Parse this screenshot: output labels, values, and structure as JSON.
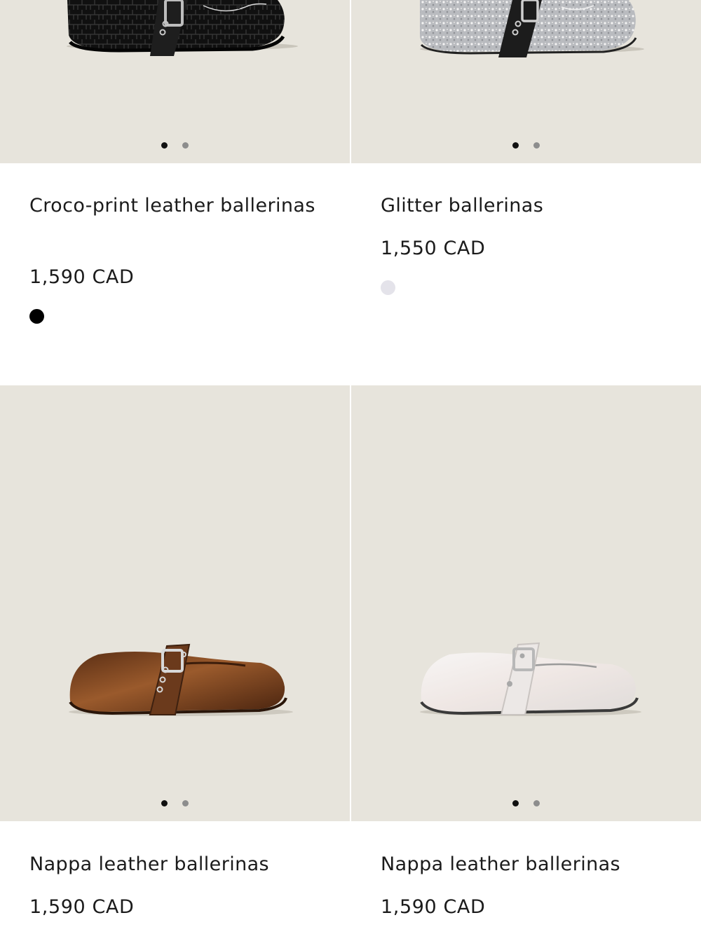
{
  "products": [
    {
      "name": "Croco-print leather ballerinas",
      "price": "1,590 CAD",
      "swatch_color": "#000000",
      "image_icon": "black-croco-ballerina-image",
      "carousel_total": 2,
      "carousel_active": 1
    },
    {
      "name": "Glitter ballerinas",
      "price": "1,550 CAD",
      "swatch_color": "#e4e3ea",
      "image_icon": "silver-glitter-ballerina-image",
      "carousel_total": 2,
      "carousel_active": 1
    },
    {
      "name": "Nappa leather ballerinas",
      "price": "1,590 CAD",
      "swatch_color": "#6b3a1c",
      "image_icon": "brown-nappa-ballerina-image",
      "carousel_total": 2,
      "carousel_active": 1
    },
    {
      "name": "Nappa leather ballerinas",
      "price": "1,590 CAD",
      "swatch_color": "#f2efed",
      "image_icon": "white-nappa-ballerina-image",
      "carousel_total": 2,
      "carousel_active": 1
    }
  ],
  "colors": {
    "image_background": "#e7e4dc",
    "dot_active": "#111111",
    "dot_inactive": "#8d8d8d"
  }
}
